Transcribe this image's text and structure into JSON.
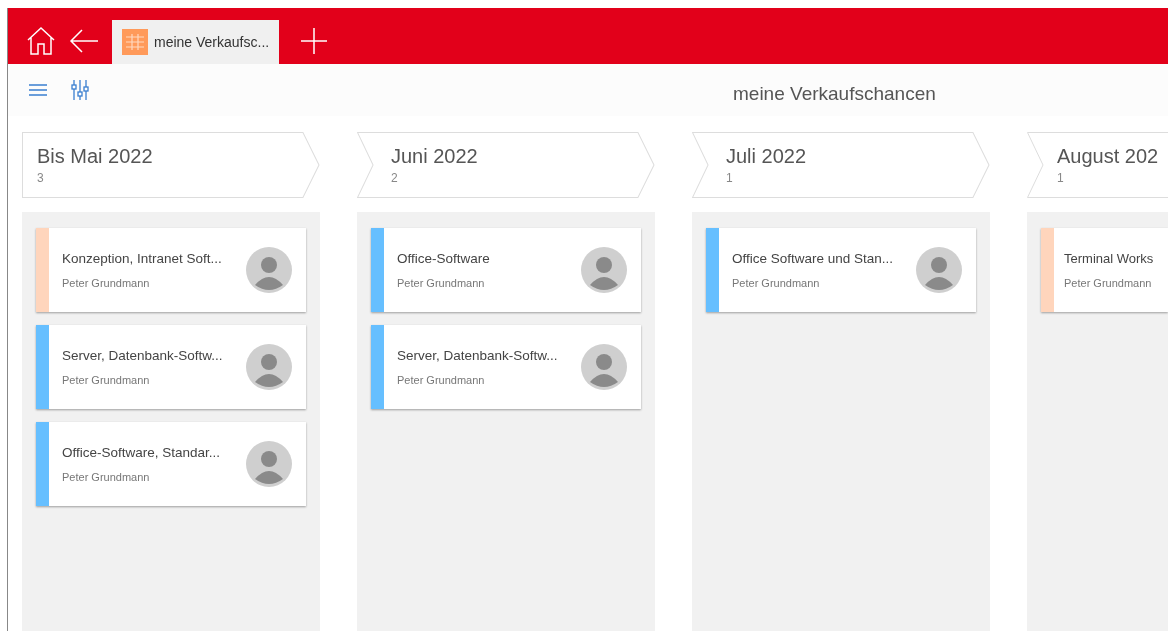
{
  "tabs": [
    {
      "label": "meine Verkaufsc...",
      "selected": true
    }
  ],
  "page_title": "meine Verkaufschancen",
  "columns": [
    {
      "title": "Bis Mai 2022",
      "count": "3",
      "cards": [
        {
          "title": "Konzeption, Intranet Soft...",
          "owner": "Peter Grundmann",
          "color": "#ffd5bc",
          "avatar": true
        },
        {
          "title": "Server, Datenbank-Softw...",
          "owner": "Peter Grundmann",
          "color": "#66bfff",
          "avatar": true
        },
        {
          "title": "Office-Software, Standar...",
          "owner": "Peter Grundmann",
          "color": "#66bfff",
          "avatar": true
        }
      ]
    },
    {
      "title": "Juni 2022",
      "count": "2",
      "cards": [
        {
          "title": "Office-Software",
          "owner": "Peter Grundmann",
          "color": "#66bfff",
          "avatar": true
        },
        {
          "title": "Server, Datenbank-Softw...",
          "owner": "Peter Grundmann",
          "color": "#66bfff",
          "avatar": true
        }
      ]
    },
    {
      "title": "Juli 2022",
      "count": "1",
      "cards": [
        {
          "title": "Office Software und Stan...",
          "owner": "Peter Grundmann",
          "color": "#66bfff",
          "avatar": true
        }
      ]
    },
    {
      "title": "August 202",
      "count": "1",
      "cards": [
        {
          "title": "Terminal Works",
          "owner": "Peter Grundmann",
          "color": "#ffd5bc",
          "avatar": false
        }
      ]
    }
  ]
}
